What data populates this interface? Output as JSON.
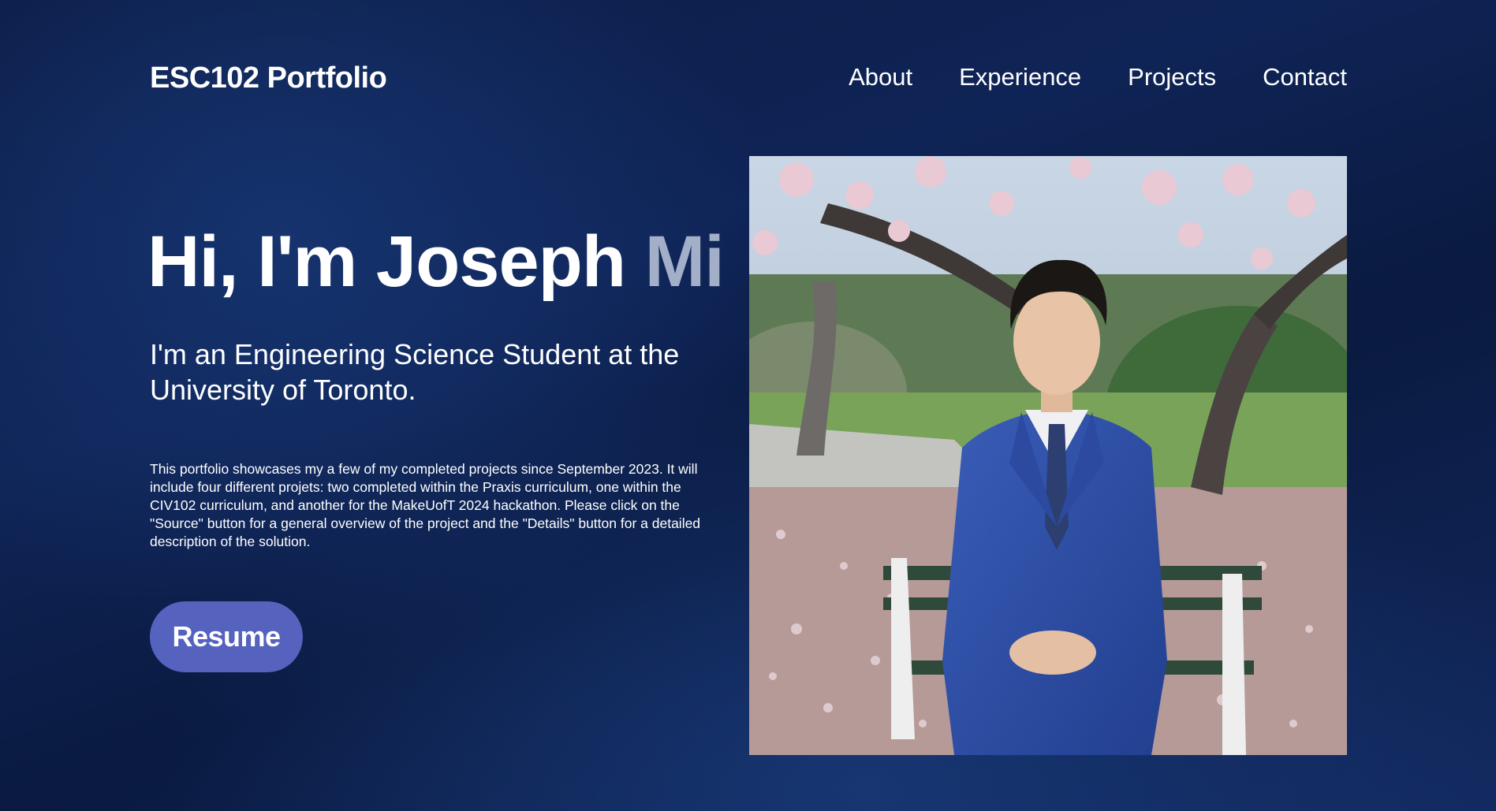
{
  "nav": {
    "brand": "ESC102 Portfolio",
    "links": [
      "About",
      "Experience",
      "Projects",
      "Contact"
    ]
  },
  "hero": {
    "greeting_main": "Hi, I'm Joseph ",
    "greeting_faded": "Mi",
    "subtitle": "I'm an Engineering Science Student at the University of Toronto.",
    "description": "This portfolio showcases my a few of my completed projects since September 2023. It will include four different projets: two completed within the Praxis curriculum, one within the CIV102 curriculum, and another for the MakeUofT 2024 hackathon. Please click on the \"Source\" button for a general overview of the project and the \"Details\" button for a detailed description of the solution.",
    "resume_label": "Resume"
  },
  "colors": {
    "background": "#0f2456",
    "button": "#5563bf",
    "faded_text": "#a3aec8"
  }
}
